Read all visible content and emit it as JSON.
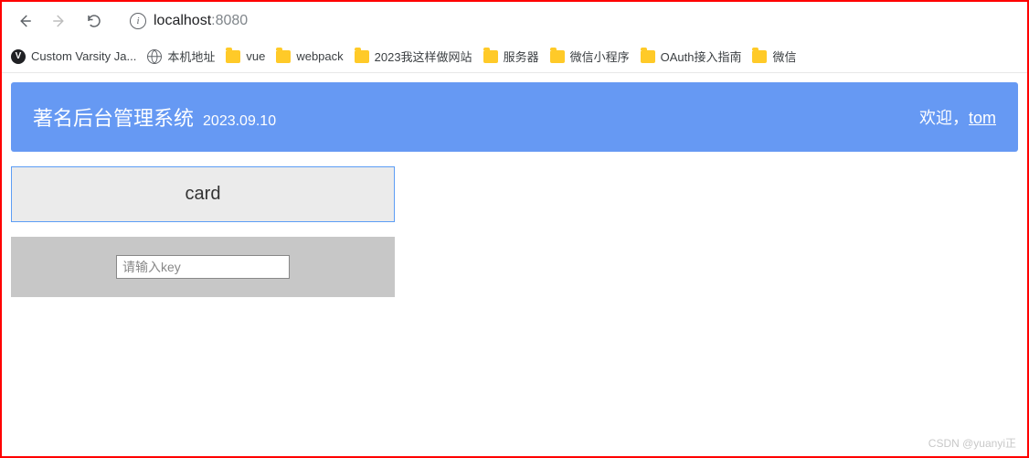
{
  "browser": {
    "url_host": "localhost",
    "url_port": ":8080"
  },
  "bookmarks": [
    {
      "label": "Custom Varsity Ja...",
      "icon": "dark-circle"
    },
    {
      "label": "本机地址",
      "icon": "globe"
    },
    {
      "label": "vue",
      "icon": "folder"
    },
    {
      "label": "webpack",
      "icon": "folder"
    },
    {
      "label": "2023我这样做网站",
      "icon": "folder"
    },
    {
      "label": "服务器",
      "icon": "folder"
    },
    {
      "label": "微信小程序",
      "icon": "folder"
    },
    {
      "label": "OAuth接入指南",
      "icon": "folder"
    },
    {
      "label": "微信",
      "icon": "folder"
    }
  ],
  "header": {
    "title": "著名后台管理系统",
    "date": "2023.09.10",
    "welcome": "欢迎，",
    "user": "tom"
  },
  "card": {
    "label": "card"
  },
  "input": {
    "placeholder": "请输入key",
    "value": ""
  },
  "watermark": "CSDN @yuanyi正"
}
